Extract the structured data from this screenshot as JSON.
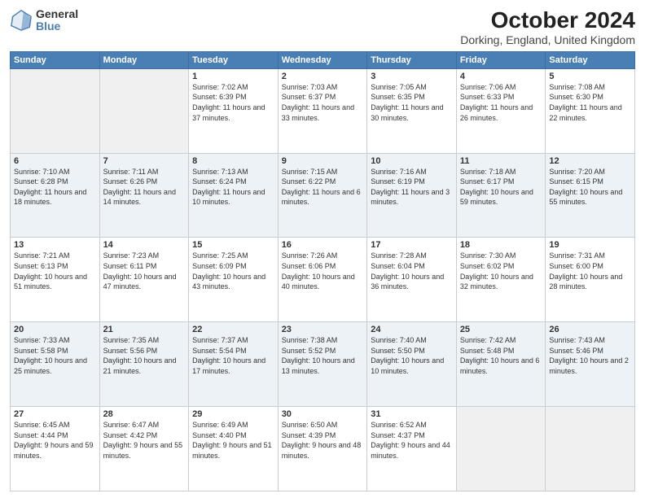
{
  "header": {
    "logo": {
      "general": "General",
      "blue": "Blue"
    },
    "title": "October 2024",
    "location": "Dorking, England, United Kingdom"
  },
  "weekdays": [
    "Sunday",
    "Monday",
    "Tuesday",
    "Wednesday",
    "Thursday",
    "Friday",
    "Saturday"
  ],
  "weeks": [
    [
      {
        "day": "",
        "empty": true
      },
      {
        "day": "",
        "empty": true
      },
      {
        "day": "1",
        "sunrise": "Sunrise: 7:02 AM",
        "sunset": "Sunset: 6:39 PM",
        "daylight": "Daylight: 11 hours and 37 minutes."
      },
      {
        "day": "2",
        "sunrise": "Sunrise: 7:03 AM",
        "sunset": "Sunset: 6:37 PM",
        "daylight": "Daylight: 11 hours and 33 minutes."
      },
      {
        "day": "3",
        "sunrise": "Sunrise: 7:05 AM",
        "sunset": "Sunset: 6:35 PM",
        "daylight": "Daylight: 11 hours and 30 minutes."
      },
      {
        "day": "4",
        "sunrise": "Sunrise: 7:06 AM",
        "sunset": "Sunset: 6:33 PM",
        "daylight": "Daylight: 11 hours and 26 minutes."
      },
      {
        "day": "5",
        "sunrise": "Sunrise: 7:08 AM",
        "sunset": "Sunset: 6:30 PM",
        "daylight": "Daylight: 11 hours and 22 minutes."
      }
    ],
    [
      {
        "day": "6",
        "sunrise": "Sunrise: 7:10 AM",
        "sunset": "Sunset: 6:28 PM",
        "daylight": "Daylight: 11 hours and 18 minutes."
      },
      {
        "day": "7",
        "sunrise": "Sunrise: 7:11 AM",
        "sunset": "Sunset: 6:26 PM",
        "daylight": "Daylight: 11 hours and 14 minutes."
      },
      {
        "day": "8",
        "sunrise": "Sunrise: 7:13 AM",
        "sunset": "Sunset: 6:24 PM",
        "daylight": "Daylight: 11 hours and 10 minutes."
      },
      {
        "day": "9",
        "sunrise": "Sunrise: 7:15 AM",
        "sunset": "Sunset: 6:22 PM",
        "daylight": "Daylight: 11 hours and 6 minutes."
      },
      {
        "day": "10",
        "sunrise": "Sunrise: 7:16 AM",
        "sunset": "Sunset: 6:19 PM",
        "daylight": "Daylight: 11 hours and 3 minutes."
      },
      {
        "day": "11",
        "sunrise": "Sunrise: 7:18 AM",
        "sunset": "Sunset: 6:17 PM",
        "daylight": "Daylight: 10 hours and 59 minutes."
      },
      {
        "day": "12",
        "sunrise": "Sunrise: 7:20 AM",
        "sunset": "Sunset: 6:15 PM",
        "daylight": "Daylight: 10 hours and 55 minutes."
      }
    ],
    [
      {
        "day": "13",
        "sunrise": "Sunrise: 7:21 AM",
        "sunset": "Sunset: 6:13 PM",
        "daylight": "Daylight: 10 hours and 51 minutes."
      },
      {
        "day": "14",
        "sunrise": "Sunrise: 7:23 AM",
        "sunset": "Sunset: 6:11 PM",
        "daylight": "Daylight: 10 hours and 47 minutes."
      },
      {
        "day": "15",
        "sunrise": "Sunrise: 7:25 AM",
        "sunset": "Sunset: 6:09 PM",
        "daylight": "Daylight: 10 hours and 43 minutes."
      },
      {
        "day": "16",
        "sunrise": "Sunrise: 7:26 AM",
        "sunset": "Sunset: 6:06 PM",
        "daylight": "Daylight: 10 hours and 40 minutes."
      },
      {
        "day": "17",
        "sunrise": "Sunrise: 7:28 AM",
        "sunset": "Sunset: 6:04 PM",
        "daylight": "Daylight: 10 hours and 36 minutes."
      },
      {
        "day": "18",
        "sunrise": "Sunrise: 7:30 AM",
        "sunset": "Sunset: 6:02 PM",
        "daylight": "Daylight: 10 hours and 32 minutes."
      },
      {
        "day": "19",
        "sunrise": "Sunrise: 7:31 AM",
        "sunset": "Sunset: 6:00 PM",
        "daylight": "Daylight: 10 hours and 28 minutes."
      }
    ],
    [
      {
        "day": "20",
        "sunrise": "Sunrise: 7:33 AM",
        "sunset": "Sunset: 5:58 PM",
        "daylight": "Daylight: 10 hours and 25 minutes."
      },
      {
        "day": "21",
        "sunrise": "Sunrise: 7:35 AM",
        "sunset": "Sunset: 5:56 PM",
        "daylight": "Daylight: 10 hours and 21 minutes."
      },
      {
        "day": "22",
        "sunrise": "Sunrise: 7:37 AM",
        "sunset": "Sunset: 5:54 PM",
        "daylight": "Daylight: 10 hours and 17 minutes."
      },
      {
        "day": "23",
        "sunrise": "Sunrise: 7:38 AM",
        "sunset": "Sunset: 5:52 PM",
        "daylight": "Daylight: 10 hours and 13 minutes."
      },
      {
        "day": "24",
        "sunrise": "Sunrise: 7:40 AM",
        "sunset": "Sunset: 5:50 PM",
        "daylight": "Daylight: 10 hours and 10 minutes."
      },
      {
        "day": "25",
        "sunrise": "Sunrise: 7:42 AM",
        "sunset": "Sunset: 5:48 PM",
        "daylight": "Daylight: 10 hours and 6 minutes."
      },
      {
        "day": "26",
        "sunrise": "Sunrise: 7:43 AM",
        "sunset": "Sunset: 5:46 PM",
        "daylight": "Daylight: 10 hours and 2 minutes."
      }
    ],
    [
      {
        "day": "27",
        "sunrise": "Sunrise: 6:45 AM",
        "sunset": "Sunset: 4:44 PM",
        "daylight": "Daylight: 9 hours and 59 minutes."
      },
      {
        "day": "28",
        "sunrise": "Sunrise: 6:47 AM",
        "sunset": "Sunset: 4:42 PM",
        "daylight": "Daylight: 9 hours and 55 minutes."
      },
      {
        "day": "29",
        "sunrise": "Sunrise: 6:49 AM",
        "sunset": "Sunset: 4:40 PM",
        "daylight": "Daylight: 9 hours and 51 minutes."
      },
      {
        "day": "30",
        "sunrise": "Sunrise: 6:50 AM",
        "sunset": "Sunset: 4:39 PM",
        "daylight": "Daylight: 9 hours and 48 minutes."
      },
      {
        "day": "31",
        "sunrise": "Sunrise: 6:52 AM",
        "sunset": "Sunset: 4:37 PM",
        "daylight": "Daylight: 9 hours and 44 minutes."
      },
      {
        "day": "",
        "empty": true
      },
      {
        "day": "",
        "empty": true
      }
    ]
  ]
}
